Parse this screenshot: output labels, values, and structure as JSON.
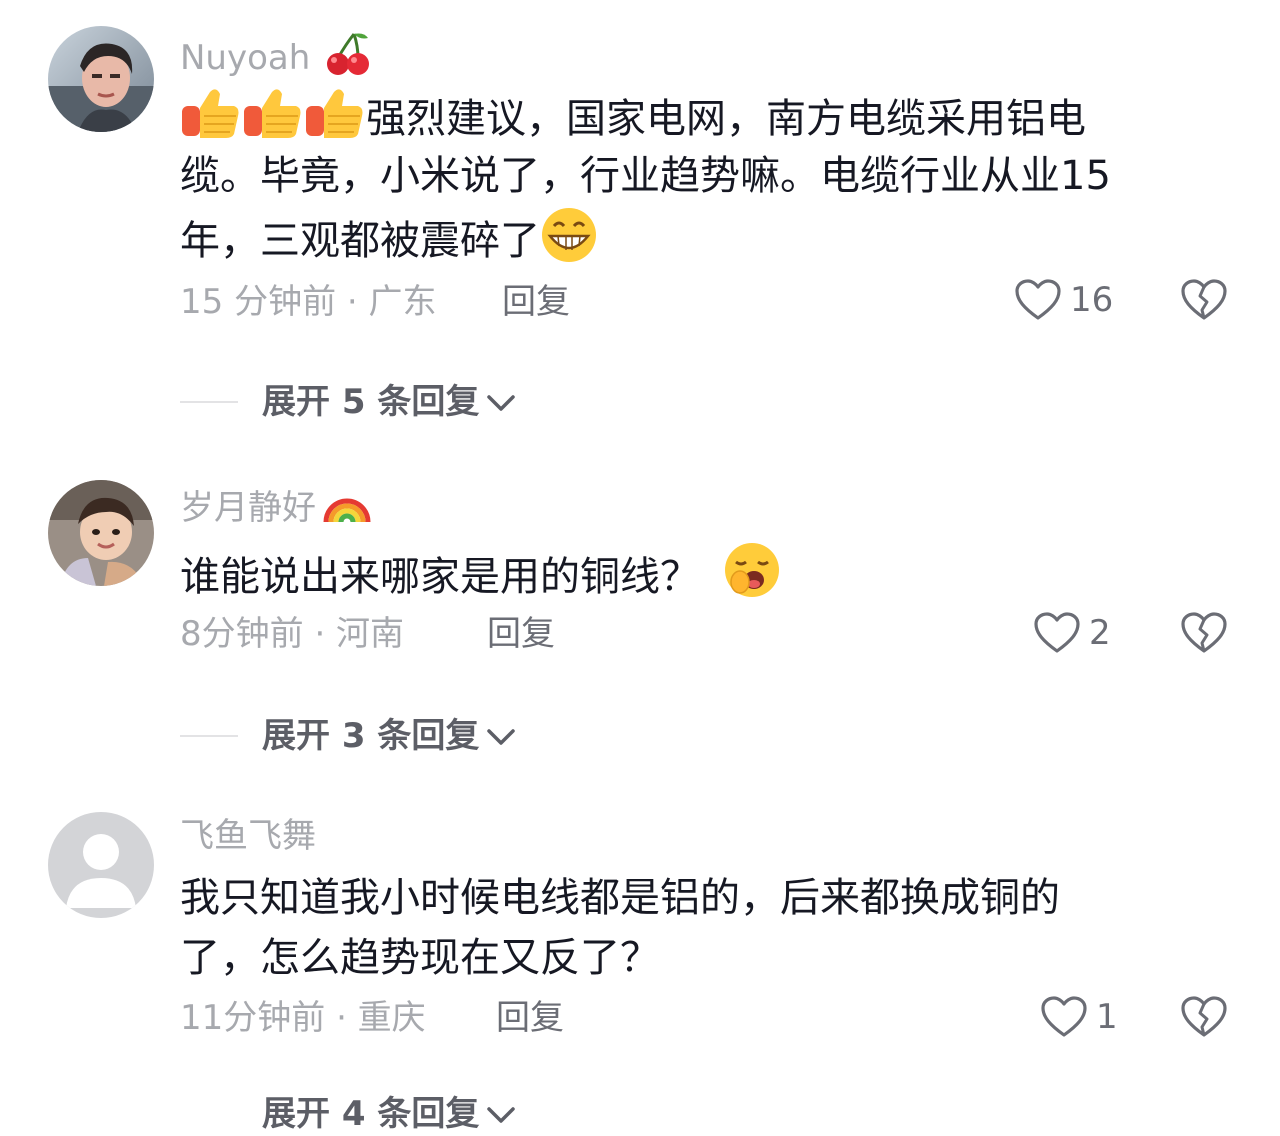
{
  "comments": [
    {
      "username": "Nuyoah",
      "badge_icon": "cherry-icon",
      "lines": [
        "强烈建议，国家电网，南方电缆采用铝电",
        "缆。毕竟，小米说了，行业趋势嘛。电缆行业从业15",
        "年，三观都被震碎了"
      ],
      "meta": "15 分钟前 · 广东",
      "reply_label": "回复",
      "likes": "16",
      "expand_label": "展开 5 条回复"
    },
    {
      "username": "岁月静好",
      "badge_icon": "rainbow-icon",
      "lines": [
        "谁能说出来哪家是用的铜线？"
      ],
      "meta": "8分钟前 · 河南",
      "reply_label": "回复",
      "likes": "2",
      "expand_label": "展开 3 条回复"
    },
    {
      "username": "飞鱼飞舞",
      "badge_icon": "",
      "lines": [
        "我只知道我小时候电线都是铝的，后来都换成铜的",
        "了，怎么趋势现在又反了？"
      ],
      "meta": "11分钟前 · 重庆",
      "reply_label": "回复",
      "likes": "1",
      "expand_label": "展开 4 条回复"
    }
  ],
  "colors": {
    "text_primary": "#161823",
    "text_secondary": "#a7a9ae",
    "text_action": "#6b6d75"
  }
}
